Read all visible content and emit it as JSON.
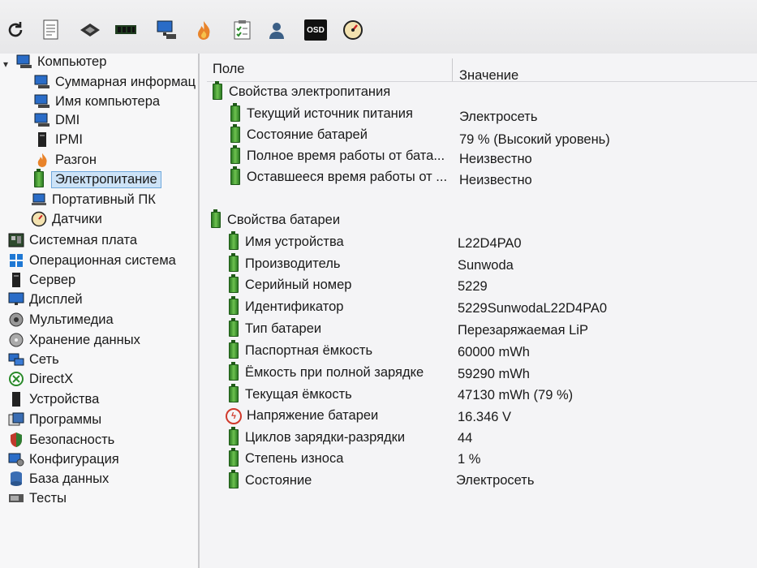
{
  "toolbar": {
    "buttons": [
      {
        "icon": "refresh-icon"
      },
      {
        "icon": "report-icon"
      },
      {
        "icon": "cpu-icon"
      },
      {
        "icon": "memory-icon"
      },
      {
        "icon": "network-computer-icon"
      },
      {
        "icon": "flame-icon"
      },
      {
        "icon": "checklist-icon"
      },
      {
        "icon": "user-icon"
      },
      {
        "icon": "osd-icon",
        "text": "OSD"
      },
      {
        "icon": "gauge-icon"
      }
    ]
  },
  "tree": {
    "root": "Компьютер",
    "children": [
      "Суммарная информац",
      "Имя компьютера",
      "DMI",
      "IPMI",
      "Разгон",
      "Электропитание",
      "Портативный ПК",
      "Датчики"
    ],
    "selected": "Электропитание",
    "sections": [
      "Системная плата",
      "Операционная система",
      "Сервер",
      "Дисплей",
      "Мультимедиа",
      "Хранение данных",
      "Сеть",
      "DirectX",
      "Устройства",
      "Программы",
      "Безопасность",
      "Конфигурация",
      "База данных",
      "Тесты"
    ]
  },
  "table": {
    "col_field": "Поле",
    "col_value": "Значение",
    "groups": [
      {
        "title": "Свойства электропитания",
        "rows": [
          {
            "field": "Текущий источник питания",
            "value": "Электросеть"
          },
          {
            "field": "Состояние батарей",
            "value": "79 % (Высокий уровень)"
          },
          {
            "field": "Полное время работы от бата...",
            "value": "Неизвестно"
          },
          {
            "field": "Оставшееся время работы от ...",
            "value": "Неизвестно"
          }
        ]
      },
      {
        "title": "Свойства батареи",
        "rows": [
          {
            "field": "Имя устройства",
            "value": "L22D4PA0"
          },
          {
            "field": "Производитель",
            "value": "Sunwoda"
          },
          {
            "field": "Серийный номер",
            "value": "5229"
          },
          {
            "field": "Идентификатор",
            "value": "5229SunwodaL22D4PA0"
          },
          {
            "field": "Тип батареи",
            "value": "Перезаряжаемая LiP"
          },
          {
            "field": "Паспортная ёмкость",
            "value": "60000 mWh"
          },
          {
            "field": "Ёмкость при полной зарядке",
            "value": "59290 mWh"
          },
          {
            "field": "Текущая ёмкость",
            "value": "47130 mWh  (79 %)"
          },
          {
            "field": "Напряжение батареи",
            "value": "16.346 V"
          },
          {
            "field": "Циклов зарядки-разрядки",
            "value": "44"
          },
          {
            "field": "Степень износа",
            "value": "1 %"
          },
          {
            "field": "Состояние",
            "value": "Электросеть"
          }
        ]
      }
    ]
  }
}
